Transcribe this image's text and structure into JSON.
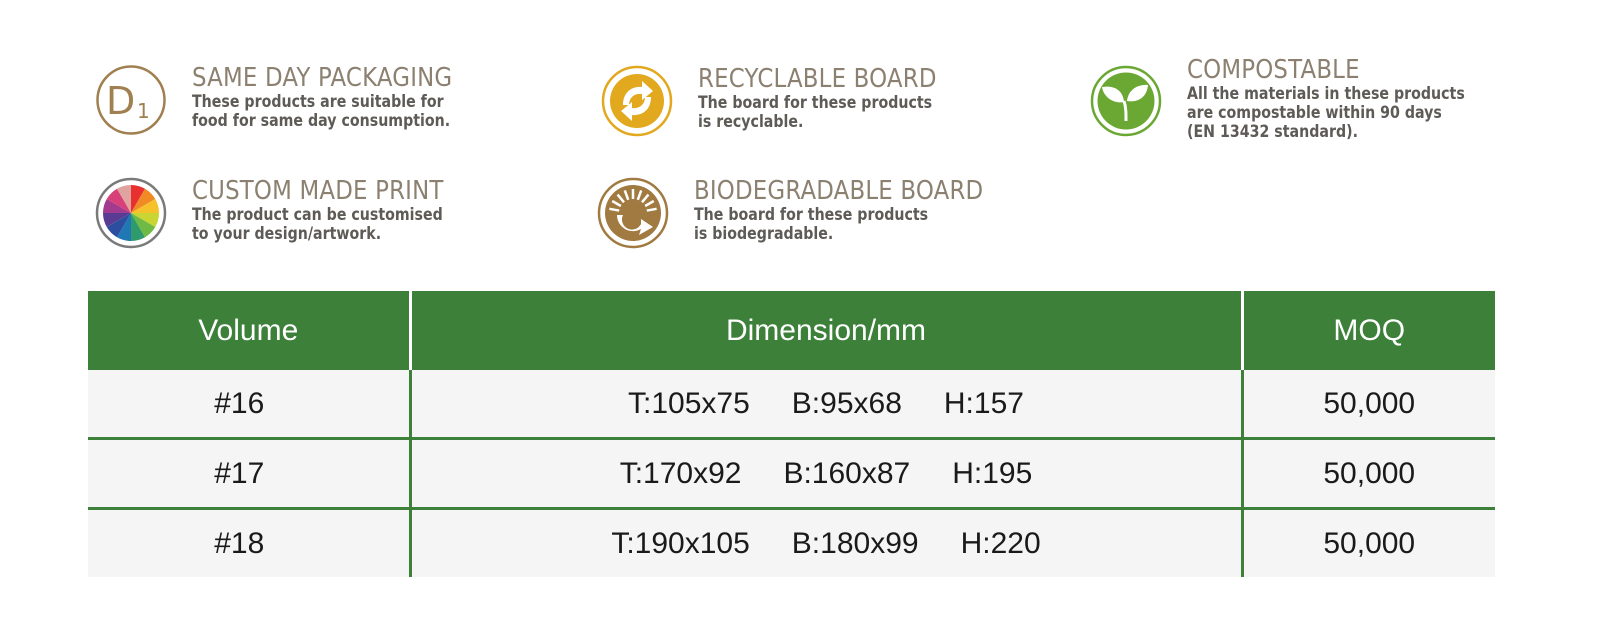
{
  "features": [
    {
      "id": "same-day",
      "icon": "d1-icon",
      "title": "SAME DAY PACKAGING",
      "desc": "These products are suitable for\nfood for same day consumption.",
      "color": "#a08050"
    },
    {
      "id": "recyclable",
      "icon": "recycle-icon",
      "title": "RECYCLABLE BOARD",
      "desc": "The board for these products\nis recyclable.",
      "color": "#e2a81e"
    },
    {
      "id": "compostable",
      "icon": "leaf-icon",
      "title": "COMPOSTABLE",
      "desc": "All the materials in these products\nare compostable within 90 days\n(EN 13432 standard).",
      "color": "#6aa833"
    },
    {
      "id": "custom-print",
      "icon": "color-wheel-icon",
      "title": "CUSTOM MADE PRINT",
      "desc": "The product can be customised\nto your design/artwork.",
      "color": "#7a7a7a"
    },
    {
      "id": "biodegradable",
      "icon": "biodegradable-icon",
      "title": "BIODEGRADABLE BOARD",
      "desc": "The board for these products\nis biodegradable.",
      "color": "#a07a40"
    }
  ],
  "table": {
    "headers": [
      "Volume",
      "Dimension/mm",
      "MOQ"
    ],
    "rows": [
      {
        "volume": "#16",
        "top": "T:105x75",
        "bottom": "B:95x68",
        "height": "H:157",
        "moq": "50,000"
      },
      {
        "volume": "#17",
        "top": "T:170x92",
        "bottom": "B:160x87",
        "height": "H:195",
        "moq": "50,000"
      },
      {
        "volume": "#18",
        "top": "T:190x105",
        "bottom": "B:180x99",
        "height": "H:220",
        "moq": "50,000"
      }
    ],
    "header_color": "#3c803a"
  }
}
